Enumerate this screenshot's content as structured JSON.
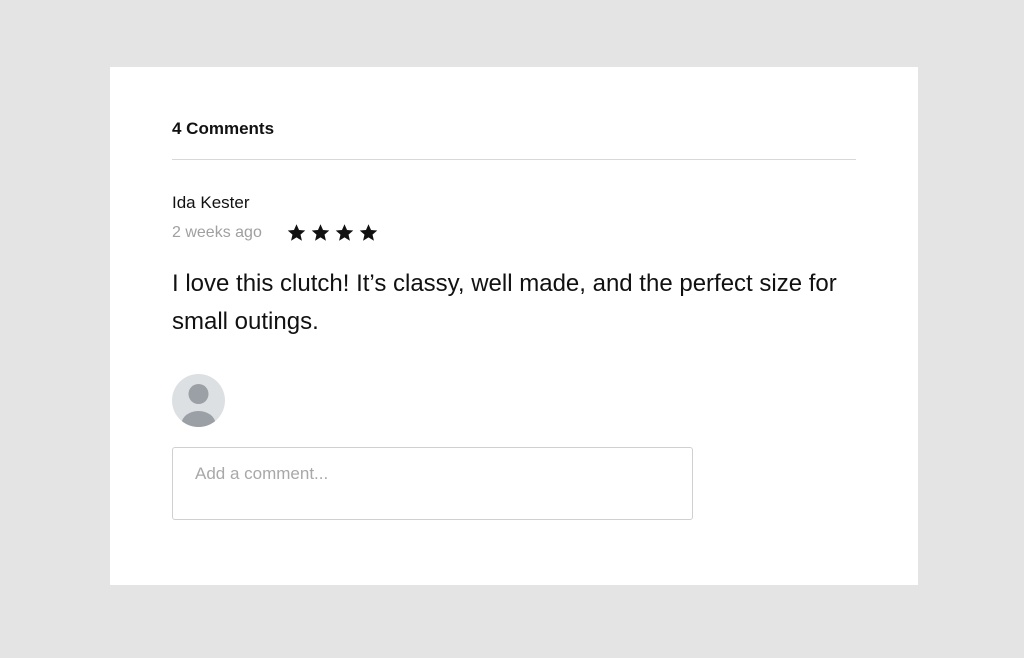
{
  "comments": {
    "count_label": "4 Comments",
    "items": [
      {
        "author": "Ida Kester",
        "time": "2 weeks ago",
        "rating": 4,
        "text": "I love this clutch! It’s classy, well made, and the perfect size for small outings."
      }
    ]
  },
  "composer": {
    "avatar_icon": "user-avatar-icon",
    "placeholder": "Add a comment..."
  },
  "colors": {
    "page_background": "#e4e4e4",
    "card_background": "#ffffff",
    "secondary_text": "#a0a0a0",
    "avatar_background": "#dde0e3",
    "avatar_figure": "#9aa0a6"
  }
}
